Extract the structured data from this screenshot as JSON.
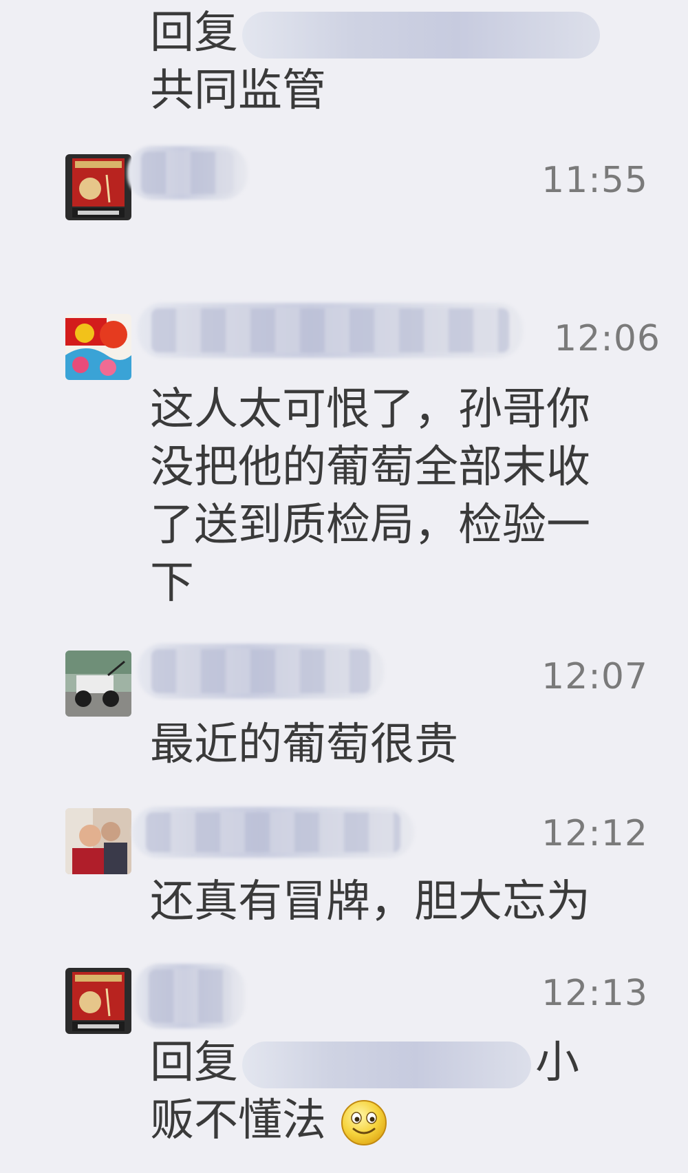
{
  "messages": [
    {
      "lines": [
        {
          "prefix": "回复",
          "suffix": ""
        },
        {
          "text": "共同监管"
        }
      ]
    },
    {
      "time": "11:55"
    },
    {
      "time": "12:06",
      "lines": [
        "这人太可恨了，孙哥你",
        "没把他的葡萄全部末收",
        "了送到质检局，检验一",
        "下"
      ]
    },
    {
      "time": "12:07",
      "lines": [
        "最近的葡萄很贵"
      ]
    },
    {
      "time": "12:12",
      "lines": [
        "还真有冒牌，胆大忘为"
      ]
    },
    {
      "time": "12:13",
      "reply_prefix": "回复",
      "reply_suffix": "小",
      "last_line": "贩不懂法",
      "emoji": "smiley-icon"
    }
  ]
}
